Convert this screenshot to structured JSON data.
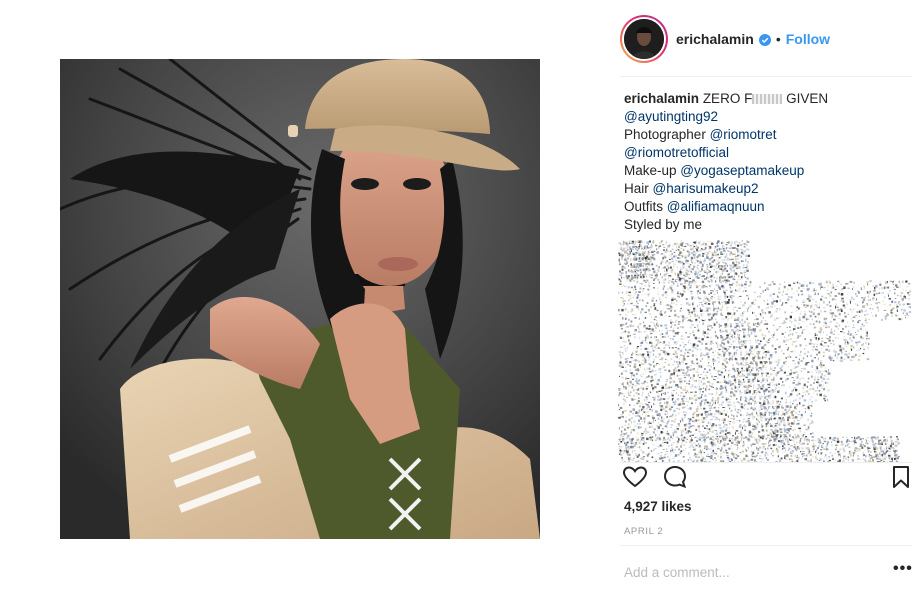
{
  "post": {
    "username": "erichalamin",
    "verified_icon": "verified-badge-icon",
    "separator": "•",
    "follow_label": "Follow"
  },
  "caption": {
    "username": "erichalamin",
    "lines": [
      {
        "prefix": "",
        "text": "ZERO F",
        "mention": "",
        "suffix": ""
      },
      {
        "prefix": "",
        "mention": "@ayutingting92"
      },
      {
        "prefix": "Photographer ",
        "mention": "@riomotret"
      },
      {
        "prefix": "",
        "mention": "@riomotretofficial"
      },
      {
        "prefix": "Make-up ",
        "mention": "@yogaseptamakeup"
      },
      {
        "prefix": "Hair ",
        "mention": "@harisumakeup2"
      },
      {
        "prefix": "Outfits ",
        "mention": "@alifiamaqnuun"
      },
      {
        "prefix": "Styled by me",
        "mention": ""
      }
    ],
    "first_line_start": "ZERO F",
    "first_line_end": "GIVEN"
  },
  "actions": {
    "like_icon": "heart-icon",
    "comment_icon": "comment-bubble-icon",
    "save_icon": "bookmark-icon"
  },
  "likes_text": "4,927 likes",
  "date_text": "APRIL 2",
  "comment": {
    "placeholder": "Add a comment...",
    "more_icon": "more-options-icon",
    "more_label": "•••"
  },
  "colors": {
    "link": "#3897f0",
    "mention": "#003569",
    "muted": "#999999",
    "text": "#262626",
    "story_ring": [
      "#f6b44a",
      "#e1306c",
      "#b32f8e"
    ]
  }
}
